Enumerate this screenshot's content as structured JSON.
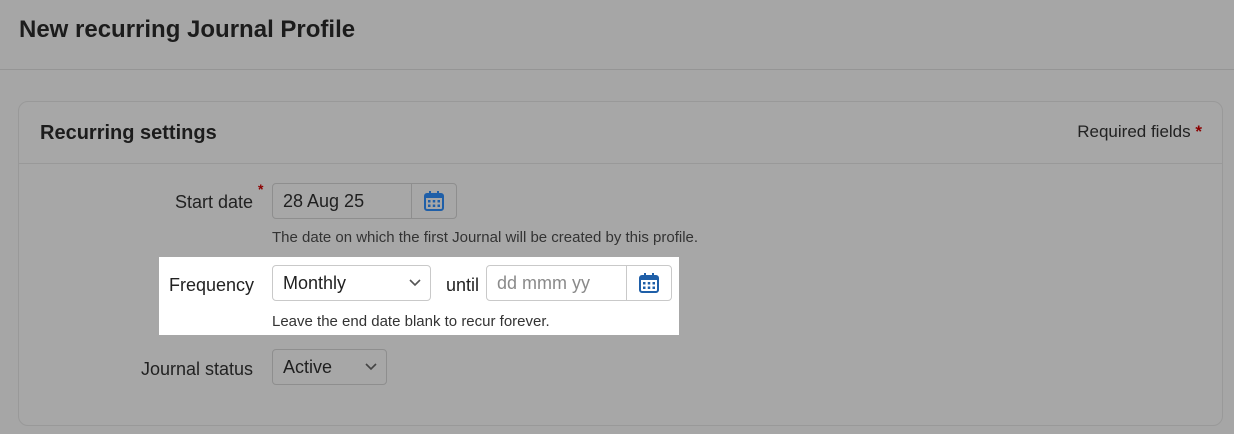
{
  "page": {
    "title": "New recurring Journal Profile"
  },
  "card": {
    "title": "Recurring settings",
    "required_label": "Required fields",
    "required_marker": "*"
  },
  "start_date": {
    "label": "Start date",
    "required_marker": "*",
    "value": "28 Aug 25",
    "help": "The date on which the first Journal will be created by this profile."
  },
  "frequency": {
    "label": "Frequency",
    "selected": "Monthly",
    "until_label": "until",
    "end_date_placeholder": "dd mmm yy",
    "help": "Leave the end date blank to recur forever."
  },
  "journal_status": {
    "label": "Journal status",
    "selected": "Active"
  },
  "colors": {
    "accent_icon": "#1f5fa8",
    "required_star": "#8b0000",
    "overlay": "#a6a6a6",
    "highlight": "#ffffff"
  },
  "icons": {
    "calendar": "calendar-icon",
    "chevron": "chevron-down-icon"
  }
}
